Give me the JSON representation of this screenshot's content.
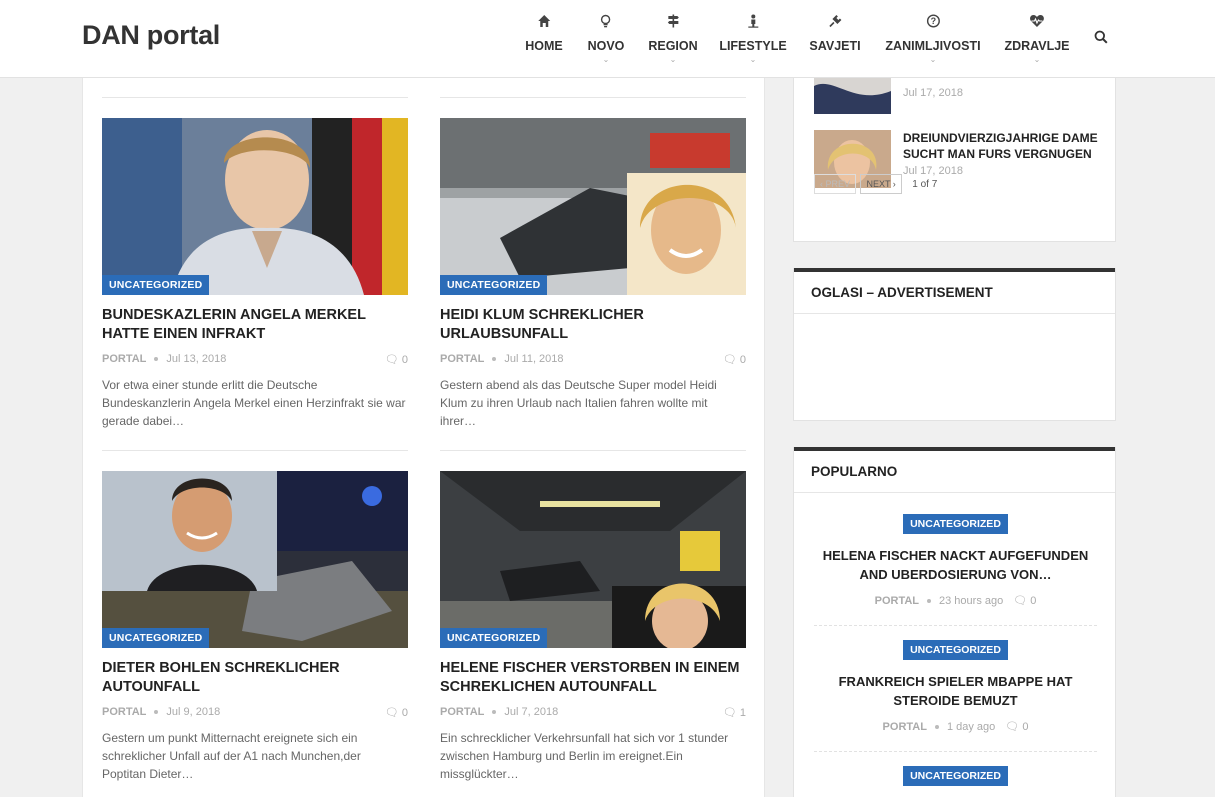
{
  "site": {
    "logo": "DAN portal"
  },
  "nav": {
    "items": [
      {
        "label": "HOME",
        "icon": "home-icon"
      },
      {
        "label": "NOVO",
        "icon": "lightbulb-icon"
      },
      {
        "label": "REGION",
        "icon": "signpost-icon"
      },
      {
        "label": "LIFESTYLE",
        "icon": "person-icon"
      },
      {
        "label": "SAVJETI",
        "icon": "plug-icon"
      },
      {
        "label": "ZANIMLJIVOSTI",
        "icon": "question-circle-icon"
      },
      {
        "label": "ZDRAVLJE",
        "icon": "heartbeat-icon"
      }
    ],
    "search_icon": "search-icon"
  },
  "posts": [
    {
      "category": "UNCATEGORIZED",
      "title": "BUNDESKAZLERIN ANGELA MERKEL HATTE EINEN INFRAKT",
      "author": "PORTAL",
      "date": "Jul 13, 2018",
      "comments": "0",
      "excerpt": "Vor etwa einer stunde erlitt die Deutsche Bundeskanzlerin Angela Merkel einen Herzinfrakt sie war gerade dabei…"
    },
    {
      "category": "UNCATEGORIZED",
      "title": "HEIDI KLUM SCHREKLICHER URLAUBSUNFALL",
      "author": "PORTAL",
      "date": "Jul 11, 2018",
      "comments": "0",
      "excerpt": "Gestern abend als das Deutsche Super model Heidi Klum zu ihren Urlaub nach Italien fahren wollte mit ihrer…"
    },
    {
      "category": "UNCATEGORIZED",
      "title": "DIETER BOHLEN SCHREKLICHER AUTOUNFALL",
      "author": "PORTAL",
      "date": "Jul 9, 2018",
      "comments": "0",
      "excerpt": "Gestern um punkt Mitternacht ereignete sich ein schreklicher Unfall auf der A1 nach Munchen,der Poptitan Dieter…"
    },
    {
      "category": "UNCATEGORIZED",
      "title": "HELENE FISCHER VERSTORBEN IN EINEM SCHREKLICHEN AUTOUNFALL",
      "author": "PORTAL",
      "date": "Jul 7, 2018",
      "comments": "1",
      "excerpt": "Ein schrecklicher Verkehrsunfall hat sich vor 1 stunder zwischen Hamburg und Berlin im ereignet.Ein missglückter…"
    }
  ],
  "sidebar": {
    "recent": [
      {
        "title": "",
        "date": "Jul 17, 2018"
      },
      {
        "title": "DREIUNDVIERZIGJAHRIGE DAME SUCHT MAN FURS VERGNUGEN",
        "date": "Jul 17, 2018"
      }
    ],
    "pager": {
      "prev": "‹ PREV",
      "next": "NEXT ›",
      "count": "1 of 7"
    },
    "ads": {
      "title": "OGLASI – ADVERTISEMENT"
    },
    "popular": {
      "title": "POPULARNO",
      "items": [
        {
          "category": "UNCATEGORIZED",
          "title": "HELENA FISCHER NACKT AUFGEFUNDEN AND UBERDOSIERUNG VON…",
          "author": "PORTAL",
          "time": "23 hours ago",
          "comments": "0"
        },
        {
          "category": "UNCATEGORIZED",
          "title": "FRANKREICH SPIELER MBAPPE HAT STEROIDE BEMUZT",
          "author": "PORTAL",
          "time": "1 day ago",
          "comments": "0"
        },
        {
          "category": "UNCATEGORIZED"
        }
      ]
    }
  },
  "colors": {
    "accent": "#2b6cb8",
    "widget_bar": "#333333"
  }
}
